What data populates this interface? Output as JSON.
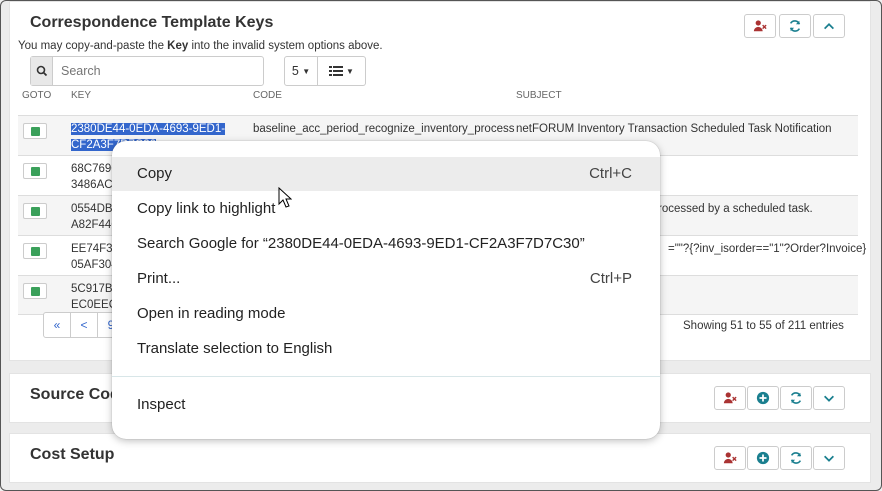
{
  "panel1": {
    "title": "Correspondence Template Keys",
    "note_prefix": "You may copy-and-paste the ",
    "note_bold": "Key",
    "note_suffix": " into the invalid system options above.",
    "search_placeholder": "Search",
    "page_size": "5",
    "columns": {
      "goto": "GOTO",
      "key": "KEY",
      "code": "CODE",
      "subject": "SUBJECT"
    },
    "rows": [
      {
        "key_line1": "2380DE44-0EDA-4693-9ED1-",
        "key_line2": "CF2A3F7D7C30",
        "code": "baseline_acc_period_recognize_inventory_process",
        "subject": "netFORUM Inventory Transaction Scheduled Task Notification"
      },
      {
        "key_line1": "68C769C",
        "key_line2": "3486ACE",
        "code": "",
        "subject": ""
      },
      {
        "key_line1": "0554DB0",
        "key_line2": "A82F446",
        "code": "",
        "subject": "rocessed by a scheduled task."
      },
      {
        "key_line1": "EE74F3E",
        "key_line2": "05AF304",
        "code": "",
        "subject": "=\"\"?{?inv_isorder==\"1\"?Order?Invoice}"
      },
      {
        "key_line1": "5C917B9",
        "key_line2": "EC0EEC7",
        "code": "",
        "subject": ""
      }
    ],
    "pager": {
      "first": "«",
      "prev": "<",
      "page": "9"
    },
    "showing": "Showing 51 to 55 of 211 entries"
  },
  "panel2": {
    "title": "Source Cod"
  },
  "panel3": {
    "title": "Cost Setup"
  },
  "context_menu": {
    "items": [
      {
        "label": "Copy",
        "shortcut": "Ctrl+C"
      },
      {
        "label": "Copy link to highlight",
        "shortcut": ""
      },
      {
        "label": "Search Google for “2380DE44-0EDA-4693-9ED1-CF2A3F7D7C30”",
        "shortcut": ""
      },
      {
        "label": "Print...",
        "shortcut": "Ctrl+P"
      },
      {
        "label": "Open in reading mode",
        "shortcut": ""
      },
      {
        "label": "Translate selection to English",
        "shortcut": ""
      },
      {
        "label": "Inspect",
        "shortcut": ""
      }
    ]
  },
  "colors": {
    "danger": "#a33",
    "accent": "#1a7f8f",
    "selection": "#3366cc"
  }
}
